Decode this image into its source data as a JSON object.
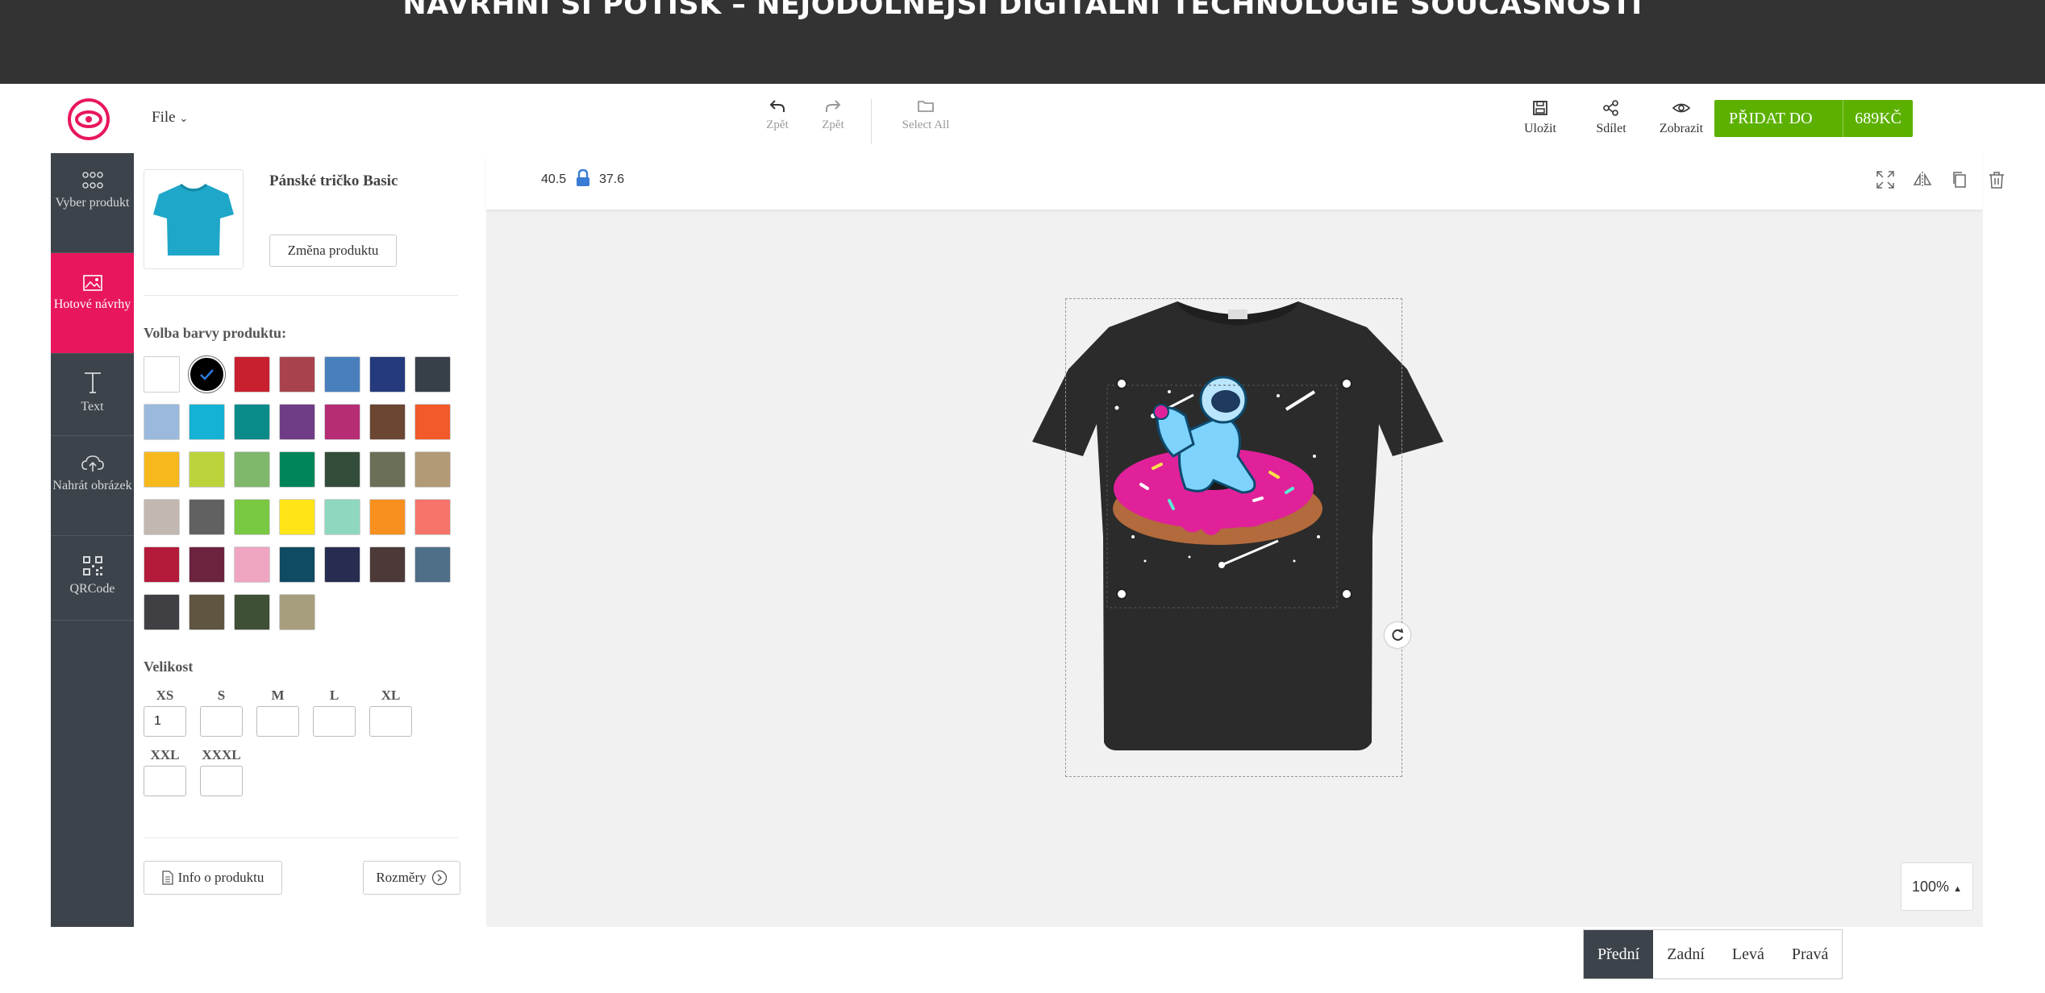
{
  "banner": {
    "title": "NAVRHNI SI POTISK – NEJODOLNĚJŠÍ DIGITÁLNÍ TECHNOLOGIE SOUČASNOSTI"
  },
  "toolbar": {
    "file_label": "File",
    "undo_label": "Zpět",
    "redo_label": "Zpět",
    "select_all_label": "Select All",
    "save_label": "Uložit",
    "share_label": "Sdílet",
    "view_label": "Zobrazit",
    "cart_label": "PŘIDAT DO KOŠÍKU",
    "cart_price": "689KČ"
  },
  "sidebar": {
    "items": [
      {
        "label": "Vyber produkt",
        "icon": "grid-icon"
      },
      {
        "label": "Hotové návrhy",
        "icon": "image-icon"
      },
      {
        "label": "Text",
        "icon": "text-icon"
      },
      {
        "label": "Nahrát obrázek",
        "icon": "cloud-upload-icon"
      },
      {
        "label": "QRCode",
        "icon": "qrcode-icon"
      }
    ],
    "active_index": 1
  },
  "product": {
    "name": "Pánské tričko Basic",
    "change_label": "Změna produktu",
    "thumb_color": "#1fa7c9"
  },
  "colors": {
    "title": "Volba barvy produktu:",
    "swatches": [
      "#ffffff",
      "#000000",
      "#c8202f",
      "#a8434d",
      "#4a7fbe",
      "#243a7c",
      "#373f48",
      "#9ab9dc",
      "#14b2d4",
      "#0b8a8a",
      "#6e3d86",
      "#b62d76",
      "#6a4633",
      "#f25a2a",
      "#f7b81d",
      "#bcd33c",
      "#7fb76b",
      "#00855a",
      "#344c3a",
      "#6b6f58",
      "#b39a77",
      "#c2b8b1",
      "#616161",
      "#7ac943",
      "#ffe517",
      "#8ed8c0",
      "#f7901e",
      "#f6746a",
      "#b41a3a",
      "#6c2340",
      "#efa4c2",
      "#0f4b63",
      "#272c51",
      "#4b3a37",
      "#4f6e88",
      "#3f3f44",
      "#5f5540",
      "#3e5036",
      "#a79e7e"
    ],
    "selected_index": 1
  },
  "sizes": {
    "title": "Velikost",
    "items": [
      {
        "label": "XS",
        "value": "1"
      },
      {
        "label": "S",
        "value": ""
      },
      {
        "label": "M",
        "value": ""
      },
      {
        "label": "L",
        "value": ""
      },
      {
        "label": "XL",
        "value": ""
      },
      {
        "label": "XXL",
        "value": ""
      },
      {
        "label": "XXXL",
        "value": ""
      }
    ]
  },
  "panel_buttons": {
    "info_label": "Info o produktu",
    "dims_label": "Rozměry"
  },
  "canvas": {
    "width_value": "40.5",
    "height_value": "37.6",
    "zoom_label": "100%",
    "shirt_color": "#2b2b2b"
  },
  "views": {
    "tabs": [
      "Přední",
      "Zadní",
      "Levá",
      "Pravá"
    ],
    "active_index": 0
  }
}
